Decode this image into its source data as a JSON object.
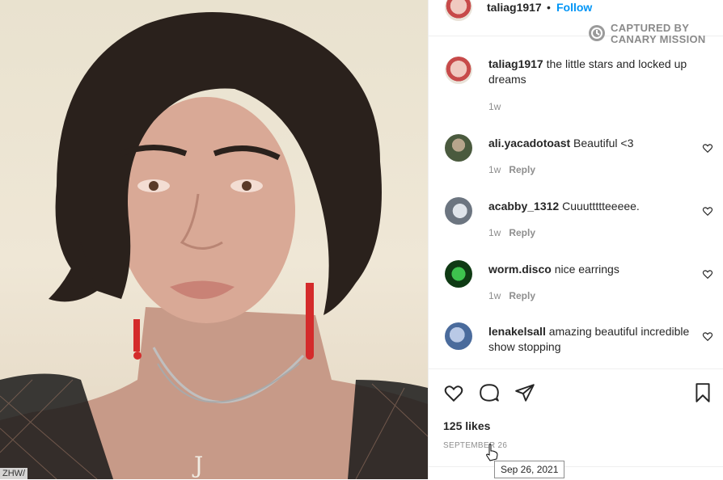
{
  "photo": {
    "caption_fragment": "ZHW/"
  },
  "header": {
    "username": "taliag1917",
    "separator": "•",
    "follow_label": "Follow"
  },
  "watermark": {
    "line1": "CAPTURED BY",
    "line2": "CANARY MISSION"
  },
  "caption_comment": {
    "username": "taliag1917",
    "text": "the little stars and locked up dreams",
    "time": "1w"
  },
  "comments": [
    {
      "username": "ali.yacadotoast",
      "text": "Beautiful <3",
      "time": "1w",
      "reply": "Reply"
    },
    {
      "username": "acabby_1312",
      "text": "Cuuuttttteeeee.",
      "time": "1w",
      "reply": "Reply"
    },
    {
      "username": "worm.disco",
      "text": "nice earrings",
      "time": "1w",
      "reply": "Reply"
    },
    {
      "username": "lenakelsall",
      "text": "amazing beautiful incredible show stopping"
    }
  ],
  "footer": {
    "likes": "125 likes",
    "date": "SEPTEMBER 26",
    "tooltip": "Sep 26, 2021"
  },
  "colors": {
    "accent": "#0095f6",
    "muted": "#8e8e8e",
    "border": "#efefef"
  }
}
